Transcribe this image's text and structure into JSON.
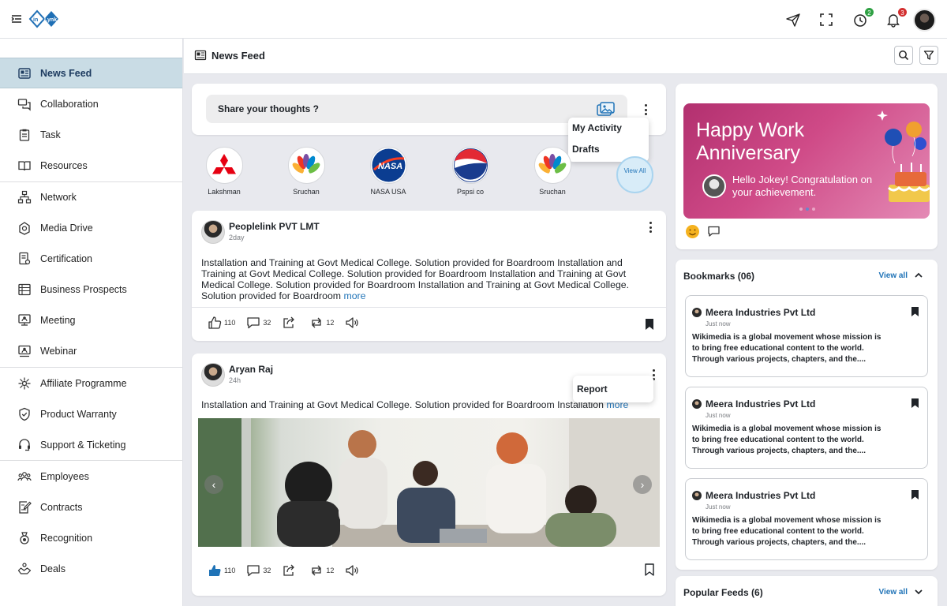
{
  "app": {
    "logo_text": "inLynk"
  },
  "topbar": {
    "icons": [
      "menu-toggle-icon",
      "send-icon",
      "fullscreen-icon",
      "timer-icon",
      "notification-bell-icon"
    ],
    "timer_badge": "2",
    "notification_badge": "3",
    "colors": {
      "timer_badge": "#2ea043",
      "notification_badge": "#d32f2f"
    }
  },
  "sidebar": {
    "items": [
      {
        "label": "News Feed",
        "icon": "newspaper-icon",
        "active": true
      },
      {
        "label": "Collaboration",
        "icon": "chat-icon"
      },
      {
        "label": "Task",
        "icon": "clipboard-icon"
      },
      {
        "label": "Resources",
        "icon": "book-icon"
      },
      {
        "label": "Network",
        "icon": "network-icon"
      },
      {
        "label": "Media Drive",
        "icon": "media-drive-icon"
      },
      {
        "label": "Certification",
        "icon": "certificate-icon"
      },
      {
        "label": "Business Prospects",
        "icon": "prospects-icon"
      },
      {
        "label": "Meeting",
        "icon": "meeting-icon"
      },
      {
        "label": "Webinar",
        "icon": "webinar-icon"
      },
      {
        "label": "Affiliate Programme",
        "icon": "affiliate-icon"
      },
      {
        "label": "Product Warranty",
        "icon": "shield-icon"
      },
      {
        "label": "Support & Ticketing",
        "icon": "headset-icon"
      },
      {
        "label": "Employees",
        "icon": "employees-icon"
      },
      {
        "label": "Contracts",
        "icon": "contract-icon"
      },
      {
        "label": "Recognition",
        "icon": "medal-icon"
      },
      {
        "label": "Deals",
        "icon": "handshake-icon"
      }
    ]
  },
  "header": {
    "title": "News Feed"
  },
  "composer": {
    "placeholder": "Share your thoughts ?",
    "menu": [
      "My Activity",
      "Drafts"
    ]
  },
  "stories": {
    "items": [
      {
        "name": "Lakshman",
        "logo": "mitsubishi-logo"
      },
      {
        "name": "Sruchan",
        "logo": "nbc-peacock-logo"
      },
      {
        "name": "NASA USA",
        "logo": "nasa-logo"
      },
      {
        "name": "Pspsi co",
        "logo": "pepsi-logo"
      },
      {
        "name": "Sruchan",
        "logo": "nbc-peacock-logo"
      }
    ],
    "view_all": "View All"
  },
  "posts": [
    {
      "author": "Peoplelink PVT LMT",
      "time": "2day",
      "text": "Installation and Training at Govt Medical College. Solution provided for Boardroom Installation and Training at Govt Medical College. Solution provided for Boardroom Installation and Training at Govt Medical College. Solution provided for Boardroom Installation and Training at Govt Medical College. Solution provided for Boardroom",
      "more": "more",
      "likes": "110",
      "comments": "32",
      "reposts": "12",
      "liked": false,
      "bookmarked": true
    },
    {
      "author": "Aryan Raj",
      "time": "24h",
      "text": "Installation and Training at Govt Medical College. Solution provided for Boardroom Installation",
      "more": "more",
      "menu": [
        "Report"
      ],
      "likes": "110",
      "comments": "32",
      "reposts": "12",
      "liked": true,
      "bookmarked": false
    }
  ],
  "anniversary": {
    "title": "Happy Work Anniversary",
    "message": "Hello Jokey! Congratulation on your achievement."
  },
  "bookmarks": {
    "title": "Bookmarks (06)",
    "view_all": "View all",
    "items": [
      {
        "title": "Meera Industries Pvt Ltd",
        "time": "Just now",
        "desc": "Wikimedia is a global movement whose mission is to bring free educational content to the world. Through various  projects, chapters, and the...."
      },
      {
        "title": "Meera Industries Pvt Ltd",
        "time": "Just now",
        "desc": "Wikimedia is a global movement whose mission is to bring free educational content to the world. Through various  projects, chapters, and the...."
      },
      {
        "title": "Meera Industries Pvt Ltd",
        "time": "Just now",
        "desc": "Wikimedia is a global movement whose mission is to bring free educational content to the world. Through various  projects, chapters, and the...."
      }
    ]
  },
  "popular": {
    "title": "Popular Feeds (6)",
    "view_all": "View all"
  },
  "colors": {
    "accent": "#1f73b7",
    "active_nav": "#c9dce5",
    "anniversary": "#c23f7c"
  }
}
